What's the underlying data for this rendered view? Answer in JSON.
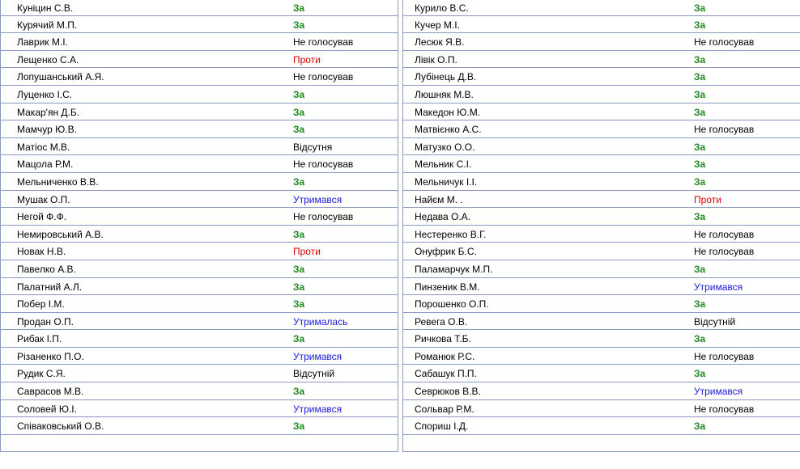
{
  "colors": {
    "za": "#1f8a1f",
    "proty": "#e00000",
    "utrymavsia": "#1a1adc",
    "neutral": "#000000",
    "grid": "#8b9bc4"
  },
  "left": [
    {
      "name": "Куніцин С.В.",
      "vote": "За",
      "type": "za"
    },
    {
      "name": "Курячий М.П.",
      "vote": "За",
      "type": "za"
    },
    {
      "name": "Лаврик М.І.",
      "vote": "Не голосував",
      "type": "ng"
    },
    {
      "name": "Лещенко С.А.",
      "vote": "Проти",
      "type": "proty"
    },
    {
      "name": "Лопушанський А.Я.",
      "vote": "Не голосував",
      "type": "ng"
    },
    {
      "name": "Луценко І.С.",
      "vote": "За",
      "type": "za"
    },
    {
      "name": "Макар'ян Д.Б.",
      "vote": "За",
      "type": "za"
    },
    {
      "name": "Мамчур Ю.В.",
      "vote": "За",
      "type": "za"
    },
    {
      "name": "Матіос М.В.",
      "vote": "Відсутня",
      "type": "vid"
    },
    {
      "name": "Мацола Р.М.",
      "vote": "Не голосував",
      "type": "ng"
    },
    {
      "name": "Мельниченко В.В.",
      "vote": "За",
      "type": "za"
    },
    {
      "name": "Мушак О.П.",
      "vote": "Утримався",
      "type": "utr"
    },
    {
      "name": "Негой Ф.Ф.",
      "vote": "Не голосував",
      "type": "ng"
    },
    {
      "name": "Немировський А.В.",
      "vote": "За",
      "type": "za"
    },
    {
      "name": "Новак Н.В.",
      "vote": "Проти",
      "type": "proty"
    },
    {
      "name": "Павелко А.В.",
      "vote": "За",
      "type": "za"
    },
    {
      "name": "Палатний А.Л.",
      "vote": "За",
      "type": "za"
    },
    {
      "name": "Побер І.М.",
      "vote": "За",
      "type": "za"
    },
    {
      "name": "Продан О.П.",
      "vote": "Утрималась",
      "type": "utr"
    },
    {
      "name": "Рибак І.П.",
      "vote": "За",
      "type": "za"
    },
    {
      "name": "Різаненко П.О.",
      "vote": "Утримався",
      "type": "utr"
    },
    {
      "name": "Рудик С.Я.",
      "vote": "Відсутній",
      "type": "vid"
    },
    {
      "name": "Саврасов М.В.",
      "vote": "За",
      "type": "za"
    },
    {
      "name": "Соловей Ю.І.",
      "vote": "Утримався",
      "type": "utr"
    },
    {
      "name": "Співаковський О.В.",
      "vote": "За",
      "type": "za"
    },
    {
      "name": "",
      "vote": "",
      "type": "ng"
    }
  ],
  "right": [
    {
      "name": "Курило В.С.",
      "vote": "За",
      "type": "za"
    },
    {
      "name": "Кучер М.І.",
      "vote": "За",
      "type": "za"
    },
    {
      "name": "Лесюк Я.В.",
      "vote": "Не голосував",
      "type": "ng"
    },
    {
      "name": "Лівік О.П.",
      "vote": "За",
      "type": "za"
    },
    {
      "name": "Лубінець Д.В.",
      "vote": "За",
      "type": "za"
    },
    {
      "name": "Люшняк М.В.",
      "vote": "За",
      "type": "za"
    },
    {
      "name": "Македон Ю.М.",
      "vote": "За",
      "type": "za"
    },
    {
      "name": "Матвієнко А.С.",
      "vote": "Не голосував",
      "type": "ng"
    },
    {
      "name": "Матузко О.О.",
      "vote": "За",
      "type": "za"
    },
    {
      "name": "Мельник С.І.",
      "vote": "За",
      "type": "za"
    },
    {
      "name": "Мельничук І.І.",
      "vote": "За",
      "type": "za"
    },
    {
      "name": "Найєм М. .",
      "vote": "Проти",
      "type": "proty"
    },
    {
      "name": "Недава О.А.",
      "vote": "За",
      "type": "za"
    },
    {
      "name": "Нестеренко В.Г.",
      "vote": "Не голосував",
      "type": "ng"
    },
    {
      "name": "Онуфрик Б.С.",
      "vote": "Не голосував",
      "type": "ng"
    },
    {
      "name": "Паламарчук М.П.",
      "vote": "За",
      "type": "za"
    },
    {
      "name": "Пинзеник В.М.",
      "vote": "Утримався",
      "type": "utr"
    },
    {
      "name": "Порошенко О.П.",
      "vote": "За",
      "type": "za"
    },
    {
      "name": "Ревега О.В.",
      "vote": "Відсутній",
      "type": "vid"
    },
    {
      "name": "Ричкова Т.Б.",
      "vote": "За",
      "type": "za"
    },
    {
      "name": "Романюк Р.С.",
      "vote": "Не голосував",
      "type": "ng"
    },
    {
      "name": "Сабашук П.П.",
      "vote": "За",
      "type": "za"
    },
    {
      "name": "Севрюков В.В.",
      "vote": "Утримався",
      "type": "utr"
    },
    {
      "name": "Сольвар Р.М.",
      "vote": "Не голосував",
      "type": "ng"
    },
    {
      "name": "Спориш І.Д.",
      "vote": "За",
      "type": "za"
    },
    {
      "name": "",
      "vote": "",
      "type": "ng"
    }
  ]
}
